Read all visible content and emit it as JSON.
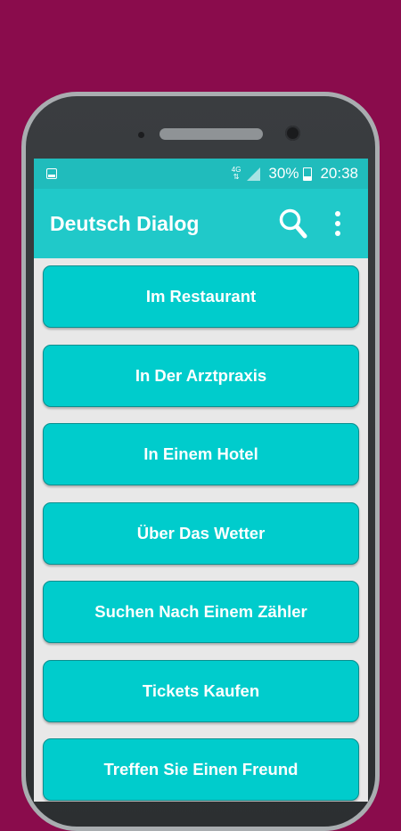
{
  "status_bar": {
    "network": "4G",
    "battery": "30%",
    "time": "20:38"
  },
  "app_bar": {
    "title": "Deutsch Dialog",
    "search_icon": "search-icon",
    "menu_icon": "more-vert-icon"
  },
  "colors": {
    "background": "#8a0c4c",
    "accent": "#20c9c9",
    "item": "#00cccc"
  },
  "items": [
    {
      "label": "Im Restaurant"
    },
    {
      "label": "In Der Arztpraxis"
    },
    {
      "label": "In Einem Hotel"
    },
    {
      "label": "Über Das Wetter"
    },
    {
      "label": "Suchen Nach Einem Zähler"
    },
    {
      "label": "Tickets Kaufen"
    },
    {
      "label": "Treffen Sie Einen Freund"
    }
  ]
}
